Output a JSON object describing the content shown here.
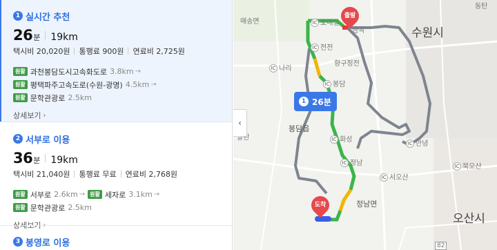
{
  "routes": [
    {
      "num": "1",
      "name": "실시간 추천",
      "minutes": "26",
      "min_unit": "분",
      "distance": "19km",
      "taxi": "택시비 20,020원",
      "toll": "통행료 900원",
      "fuel": "연료비 2,725원",
      "badge": "원활",
      "roads": [
        {
          "name": "과천봉담도시고속화도로",
          "km": "3.8km"
        },
        {
          "name": "평택파주고속도로(수원-광명)",
          "km": "4.5km"
        },
        {
          "name": "문학관광로",
          "km": "2.5km"
        }
      ],
      "detail": "상세보기"
    },
    {
      "num": "2",
      "name": "서부로 이용",
      "minutes": "36",
      "min_unit": "분",
      "distance": "19km",
      "taxi": "택시비 21,040원",
      "toll": "통행료 무료",
      "fuel": "연료비 2,768원",
      "badge": "원활",
      "roads_line1": [
        {
          "name": "서부로",
          "km": "2.6km"
        },
        {
          "name": "세자로",
          "km": "3.1km"
        }
      ],
      "roads_line2": {
        "name": "문학관광로",
        "km": "2.5km"
      },
      "detail": "상세보기"
    },
    {
      "num": "3",
      "name": "봉영로 이용"
    }
  ],
  "map": {
    "bubble_num": "1",
    "bubble_time": "26분",
    "start": "출발",
    "end": "도착",
    "ic_label": "IC",
    "labels": {
      "maesong": "매송면",
      "suwon": "수원시",
      "hotmaesil": "호매실",
      "geumgok": "금곡",
      "jeonseon": "전전",
      "nari": "나리",
      "hyanggu": "향구정전",
      "bongdam_ic": "봉담",
      "bongdam": "봉담읍",
      "palyan": "팔탄",
      "hwaseong": "화성",
      "jeongnam_ic": "정남",
      "jeongnam": "정남면",
      "seoosan": "서오산",
      "anyong": "안녕",
      "bukosan": "북오산",
      "osan": "오산시",
      "dongtan": "동탄",
      "r82": "82"
    },
    "colors": {
      "route_green": "#3bb54a",
      "route_yellow": "#f4b400",
      "route_red": "#e53935",
      "alt_route": "#7e858e",
      "accent": "#3b78e7"
    }
  }
}
